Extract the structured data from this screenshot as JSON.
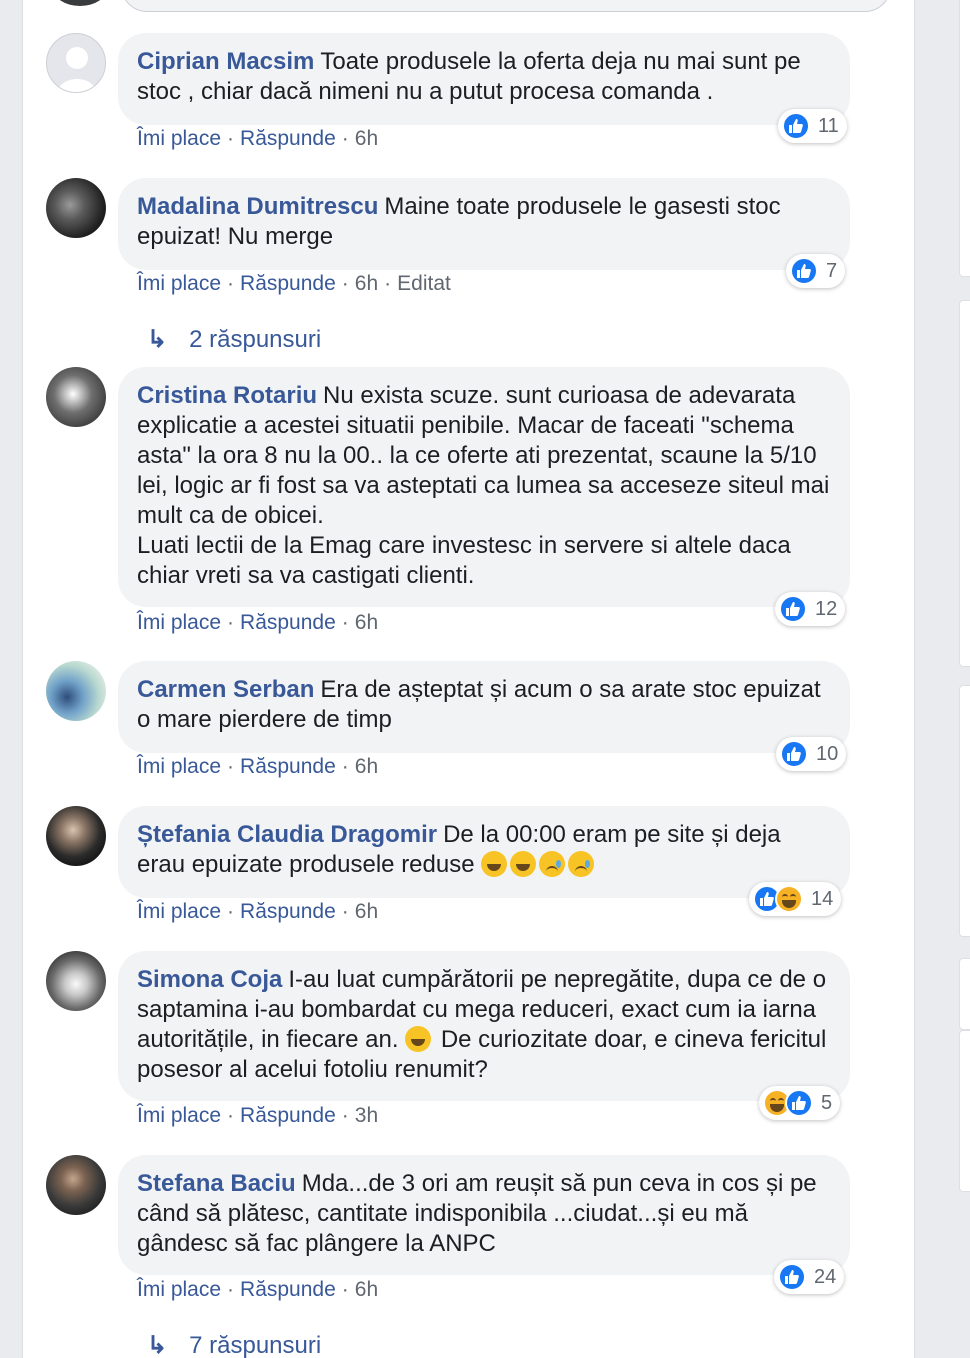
{
  "ui": {
    "like_label": "Îmi place",
    "reply_label": "Răspunde",
    "separator": "·",
    "reply_arrow": "↳"
  },
  "colors": {
    "link": "#385898",
    "bubble": "#f2f3f5",
    "like_blue": "#1877f2",
    "haha_yellow": "#f7b125"
  },
  "comments": [
    {
      "author": "Ciprian Macsim",
      "text": "Toate produsele la oferta deja nu mai sunt pe stoc , chiar dacă nimeni nu a putut procesa comanda .",
      "time": "6h",
      "reactions": [
        "like"
      ],
      "reaction_count": "11"
    },
    {
      "author": "Madalina Dumitrescu",
      "text": "Maine toate produsele le gasesti stoc epuizat! Nu merge",
      "time": "6h",
      "edited": "Editat",
      "reactions": [
        "like"
      ],
      "reaction_count": "7",
      "replies": "2 răspunsuri"
    },
    {
      "author": "Cristina Rotariu",
      "text": "Nu exista scuze. sunt curioasa de adevarata explicatie a acestei situatii penibile. Macar de faceati \"schema asta\" la ora 8 nu la 00.. la ce oferte ati prezentat, scaune la 5/10 lei, logic ar fi fost sa va asteptati ca lumea sa acceseze siteul mai mult ca de obicei.",
      "text2": "Luati lectii de la Emag care investesc in servere si altele daca chiar vreti sa va castigati clienti.",
      "time": "6h",
      "reactions": [
        "like"
      ],
      "reaction_count": "12"
    },
    {
      "author": "Carmen Serban",
      "text": "Era de așteptat și acum o sa arate stoc epuizat o mare pierdere de timp",
      "time": "6h",
      "reactions": [
        "like"
      ],
      "reaction_count": "10"
    },
    {
      "author": "Ștefania Claudia Dragomir",
      "text": "De la 00:00 eram pe site și deja erau epuizate produsele reduse",
      "emojis": [
        "rolling-laughing-emoji",
        "rolling-laughing-emoji",
        "sad-tear-emoji",
        "sad-tear-emoji"
      ],
      "time": "6h",
      "reactions": [
        "like",
        "haha"
      ],
      "reaction_count": "14"
    },
    {
      "author": "Simona Coja",
      "text": "I-au luat cumpărătorii pe nepregătite, dupa ce de o saptamina i-au bombardat cu mega reduceri, exact cum ia iarna autoritățile, in fiecare an.",
      "text_after": "De curiozitate doar, e cineva fericitul posesor al acelui fotoliu renumit?",
      "emoji_inline": "tears-of-joy-emoji",
      "time": "3h",
      "reactions": [
        "haha",
        "like"
      ],
      "reaction_count": "5"
    },
    {
      "author": "Stefana Baciu",
      "text": "Mda...de 3 ori am reușit să pun ceva in cos și pe când să plătesc, cantitate indisponibila ...ciudat...și eu mă gândesc să fac plângere la ANPC",
      "time": "6h",
      "reactions": [
        "like"
      ],
      "reaction_count": "24",
      "replies": "7 răspunsuri"
    }
  ]
}
